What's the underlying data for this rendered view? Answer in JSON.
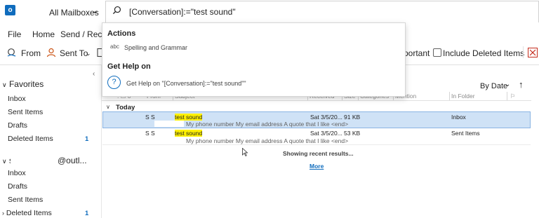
{
  "titlebar": {
    "app_icon_name": "outlook-icon",
    "app_icon_letter": "o",
    "mailbox_scope": "All Mailboxes",
    "search_query": "[Conversation]:=\"test sound\""
  },
  "ribbon": {
    "tabs": [
      "File",
      "Home",
      "Send / Recei"
    ],
    "from_label": "From",
    "sent_to_label": "Sent To",
    "important_label": "portant",
    "include_deleted_label": "Include Deleted Items"
  },
  "dropdown": {
    "actions_heading": "Actions",
    "spell_icon_text": "abc",
    "spelling_label": "Spelling and Grammar",
    "help_heading": "Get Help on",
    "help_label": "Get Help on \"[Conversation]:=\"test sound\"\""
  },
  "leftpane": {
    "favorites_heading": "Favorites",
    "favorites": [
      {
        "label": "Inbox",
        "count": ""
      },
      {
        "label": "Sent Items",
        "count": ""
      },
      {
        "label": "Drafts",
        "count": ""
      },
      {
        "label": "Deleted Items",
        "count": "1"
      }
    ],
    "account_prefix": "s",
    "account_suffix": "@outl...",
    "account_folders": [
      {
        "label": "Inbox",
        "count": ""
      },
      {
        "label": "Drafts",
        "count": ""
      },
      {
        "label": "Sent Items",
        "count": ""
      },
      {
        "label": "Deleted Items",
        "count": "1"
      }
    ]
  },
  "messages": {
    "sort_label": "By Date",
    "columns": {
      "from": "From",
      "subject": "Subject",
      "received": "Received",
      "size": "Size",
      "categories": "Categories",
      "mention": "Mention",
      "in_folder": "In Folder"
    },
    "group_label": "Today",
    "rows": [
      {
        "from": "S S",
        "subject": "test sound",
        "received": "Sat 3/5/20...",
        "size": "91 KB",
        "preview": "My phone number  My email address  A quote that I like <end>",
        "folder": "Inbox"
      },
      {
        "from": "S S",
        "subject": "test sound",
        "received": "Sat 3/5/20...",
        "size": "53 KB",
        "preview": "My phone number  My email address  A quote that I like <end>",
        "folder": "Sent Items"
      }
    ],
    "status_text": "Showing recent results...",
    "more_link": "More"
  },
  "colors": {
    "accent": "#0f6cbd",
    "selection": "#cfe2f6",
    "highlight": "#fff100"
  }
}
